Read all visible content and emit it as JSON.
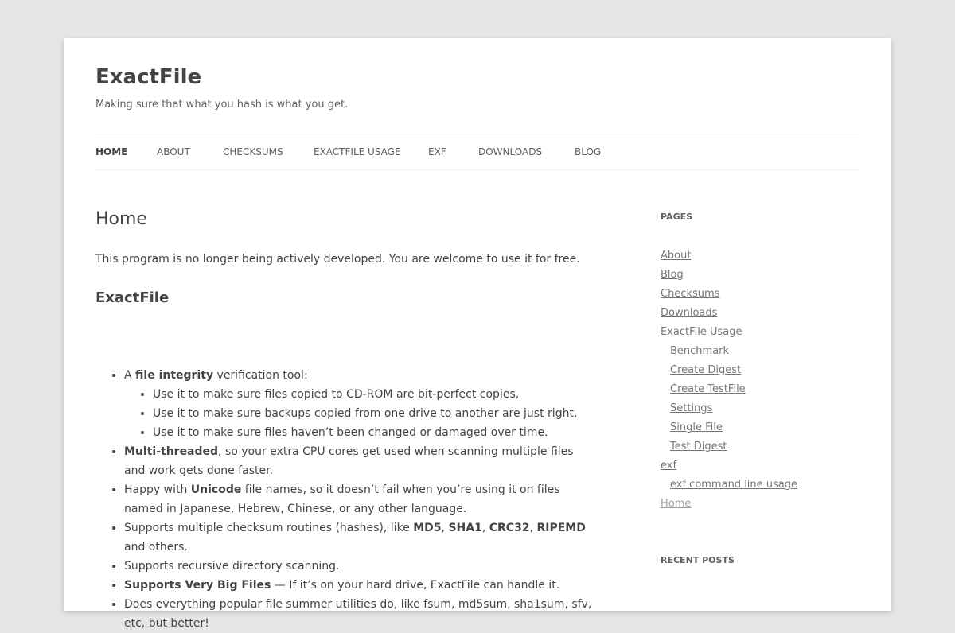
{
  "site": {
    "title": "ExactFile",
    "description": "Making sure that what you hash is what you get."
  },
  "nav": [
    {
      "label": "HOME",
      "current": true
    },
    {
      "label": "ABOUT"
    },
    {
      "label": "CHECKSUMS"
    },
    {
      "label": "EXACTFILE USAGE"
    },
    {
      "label": "EXF"
    },
    {
      "label": "DOWNLOADS"
    },
    {
      "label": "BLOG"
    }
  ],
  "main": {
    "title": "Home",
    "intro": "This program is no longer being actively developed. You are welcome to use it for free.",
    "section_heading": "ExactFile",
    "features": {
      "f1": {
        "a": "A ",
        "b": "file integrity",
        "c": " verification tool:"
      },
      "f1_sub": [
        "Use it to make sure files copied to CD-ROM are bit-perfect copies,",
        "Use it to make sure backups copied from one drive to another are just right,",
        "Use it to make sure files haven’t been changed or damaged over time."
      ],
      "f2": {
        "b": "Multi-threaded",
        "c": ", so your extra CPU cores get used when scanning multiple files and work gets done faster."
      },
      "f3": {
        "a": "Happy with ",
        "b": "Unicode",
        "c": " file names, so it doesn’t fail when you’re using it on files named in Japanese, Hebrew, Chinese, or any other language."
      },
      "f4": {
        "a": "Supports multiple checksum routines (hashes), like ",
        "md5": "MD5",
        "s1": ", ",
        "sha1": "SHA1",
        "s2": ", ",
        "crc32": "CRC32",
        "s3": ", ",
        "ripemd": "RIPEMD",
        "end": " and others."
      },
      "f5": "Supports recursive directory scanning.",
      "f6": {
        "b": "Supports Very Big Files",
        "c": " — If it’s on your hard drive, ExactFile can handle it."
      },
      "f7": "Does everything popular file summer utilities do, like fsum, md5sum, sha1sum, sfv, etc, but better!"
    }
  },
  "sidebar": {
    "pages_title": "PAGES",
    "pages": [
      {
        "label": "About"
      },
      {
        "label": "Blog"
      },
      {
        "label": "Checksums"
      },
      {
        "label": "Downloads"
      },
      {
        "label": "ExactFile Usage"
      },
      {
        "label": "Benchmark",
        "child": true
      },
      {
        "label": "Create Digest",
        "child": true
      },
      {
        "label": "Create TestFile",
        "child": true
      },
      {
        "label": "Settings",
        "child": true
      },
      {
        "label": "Single File",
        "child": true
      },
      {
        "label": "Test Digest",
        "child": true
      },
      {
        "label": "exf"
      },
      {
        "label": "exf command line usage",
        "child": true
      },
      {
        "label": "Home",
        "current": true
      }
    ],
    "recent_title": "RECENT POSTS"
  }
}
